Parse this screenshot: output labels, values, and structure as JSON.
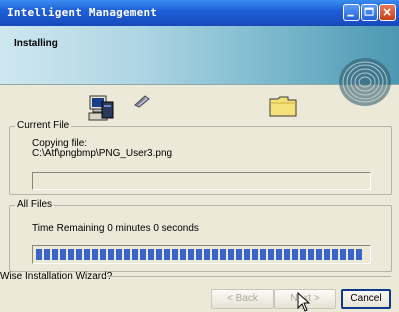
{
  "window": {
    "title": "Intelligent Management"
  },
  "header": {
    "title": "Installing"
  },
  "current_file": {
    "legend": "Current File",
    "label": "Copying file:",
    "path": "C:\\Atf\\pngbmp\\PNG_User3.png",
    "progress": 0
  },
  "all_files": {
    "legend": "All Files",
    "time_remaining": "Time Remaining 0 minutes 0 seconds",
    "progress": 1.0
  },
  "footer": {
    "brand": "Wise Installation Wizard?"
  },
  "buttons": {
    "back": "< Back",
    "next": "Next >",
    "cancel": "Cancel"
  },
  "colors": {
    "titlebar": "#1e5fd7",
    "progress": "#3a64c8",
    "dialog_bg": "#ece9d8"
  },
  "icons": [
    "computer-icon",
    "disk-icon",
    "folder-icon",
    "fingerprint-icon",
    "mouse-cursor-icon"
  ]
}
